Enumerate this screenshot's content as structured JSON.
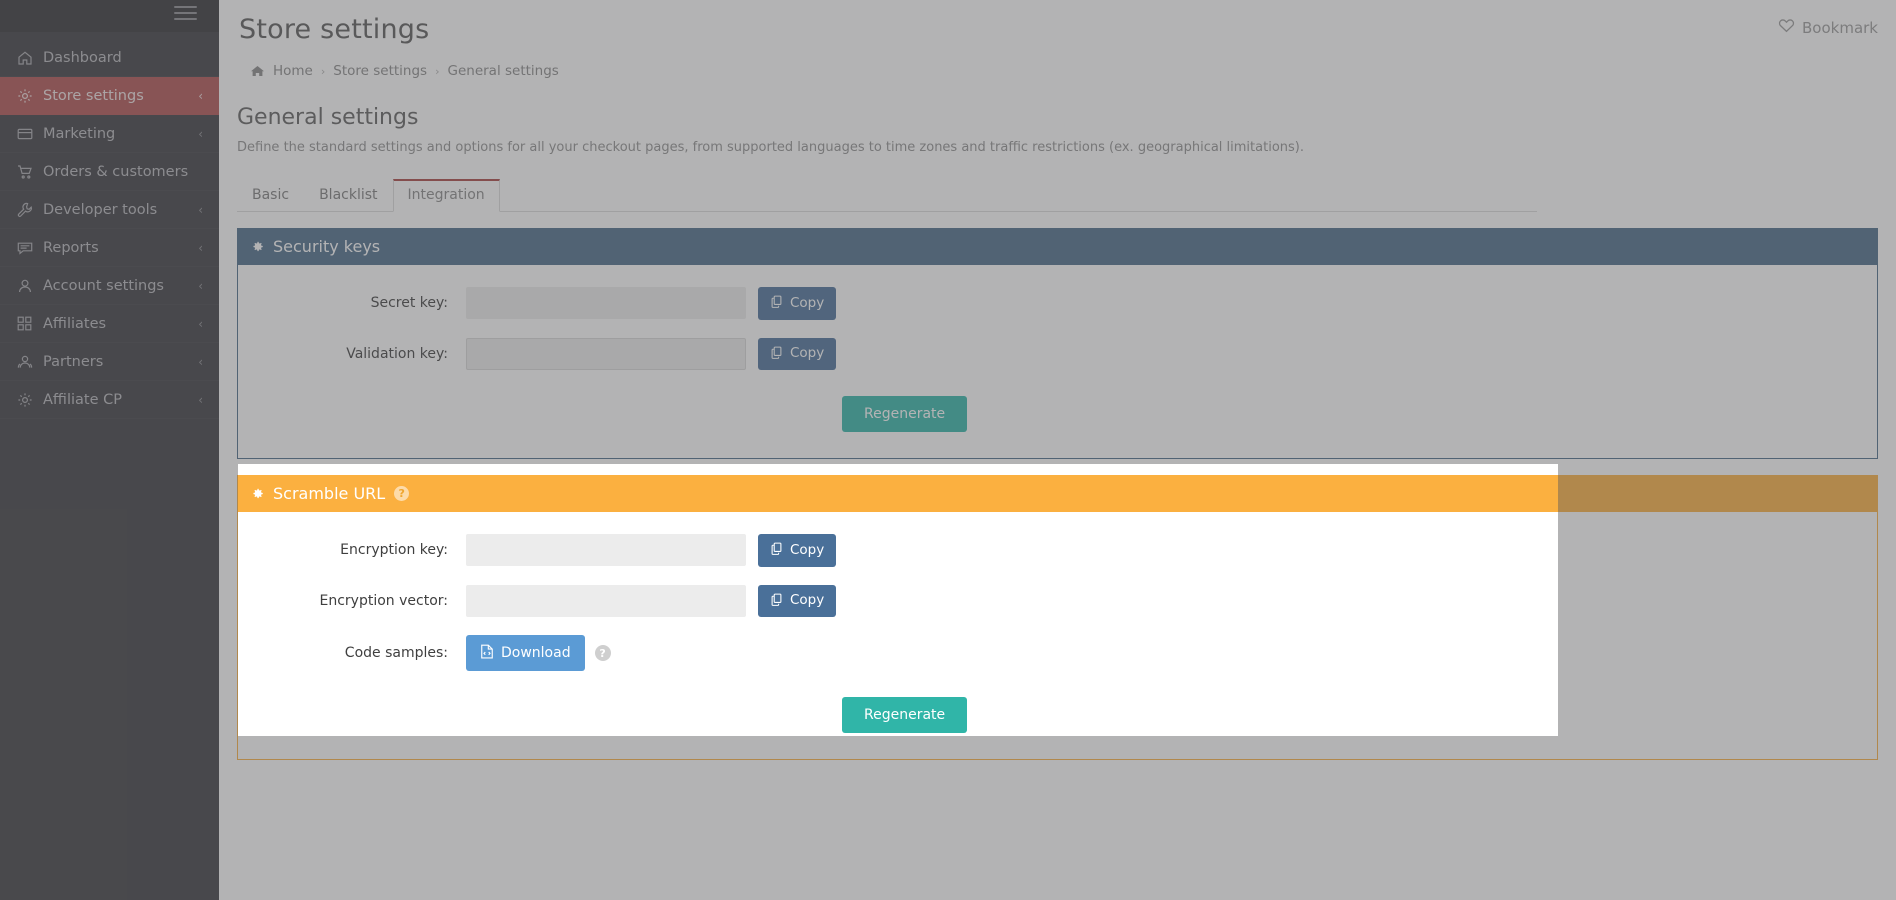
{
  "sidebar": {
    "hamburger_label": "toggle-menu",
    "items": [
      {
        "label": "Dashboard",
        "icon": "home-icon",
        "caret": false,
        "active": false
      },
      {
        "label": "Store settings",
        "icon": "gear-icon",
        "caret": true,
        "active": true
      },
      {
        "label": "Marketing",
        "icon": "card-icon",
        "caret": true,
        "active": false
      },
      {
        "label": "Orders & customers",
        "icon": "cart-icon",
        "caret": false,
        "active": false
      },
      {
        "label": "Developer tools",
        "icon": "wrench-icon",
        "caret": true,
        "active": false
      },
      {
        "label": "Reports",
        "icon": "comment-icon",
        "caret": true,
        "active": false
      },
      {
        "label": "Account settings",
        "icon": "user-icon",
        "caret": true,
        "active": false
      },
      {
        "label": "Affiliates",
        "icon": "grid-icon",
        "caret": true,
        "active": false
      },
      {
        "label": "Partners",
        "icon": "users-icon",
        "caret": true,
        "active": false
      },
      {
        "label": "Affiliate CP",
        "icon": "gear-icon",
        "caret": true,
        "active": false
      }
    ]
  },
  "header": {
    "title": "Store settings",
    "bookmark_label": "Bookmark",
    "bookmark_icon": "heart-icon"
  },
  "breadcrumb": {
    "home_icon": "home-icon",
    "items": [
      "Home",
      "Store settings",
      "General settings"
    ],
    "separator": "›"
  },
  "section": {
    "title": "General settings",
    "description": "Define the standard settings and options for all your checkout pages, from supported languages to time zones and traffic restrictions (ex. geographical limitations)."
  },
  "tabs": [
    {
      "label": "Basic",
      "active": false
    },
    {
      "label": "Blacklist",
      "active": false
    },
    {
      "label": "Integration",
      "active": true
    }
  ],
  "security_panel": {
    "header_title": "Security keys",
    "header_icon": "gear-icon",
    "header_color": "#4a6b8a",
    "fields": [
      {
        "label": "Secret key:",
        "value": "",
        "placeholder": "",
        "copy_label": "Copy",
        "copy_icon": "copy-icon"
      },
      {
        "label": "Validation key:",
        "value": "",
        "placeholder": "",
        "copy_label": "Copy",
        "copy_icon": "copy-icon"
      }
    ],
    "regenerate_label": "Regenerate"
  },
  "scramble_panel": {
    "header_title": "Scramble URL",
    "header_icon": "gear-icon",
    "header_help_icon": "question-circle-icon",
    "header_color": "#fbb040",
    "fields": [
      {
        "label": "Encryption key:",
        "value": "",
        "placeholder": "",
        "copy_label": "Copy",
        "copy_icon": "copy-icon"
      },
      {
        "label": "Encryption vector:",
        "value": "",
        "placeholder": "",
        "copy_label": "Copy",
        "copy_icon": "copy-icon"
      }
    ],
    "code_samples_label": "Code samples:",
    "download_label": "Download",
    "download_icon": "file-code-icon",
    "download_help_icon": "question-circle-icon",
    "regenerate_label": "Regenerate"
  },
  "colors": {
    "sidebar_bg": "#3a3a3f",
    "active_nav": "#b05050",
    "security_header": "#4a6b8a",
    "scramble_header": "#fbb040",
    "copy_button": "#4a7099",
    "download_button": "#5b9bd5",
    "regenerate_button": "#30b5a8",
    "tab_active_border": "#a94442"
  }
}
